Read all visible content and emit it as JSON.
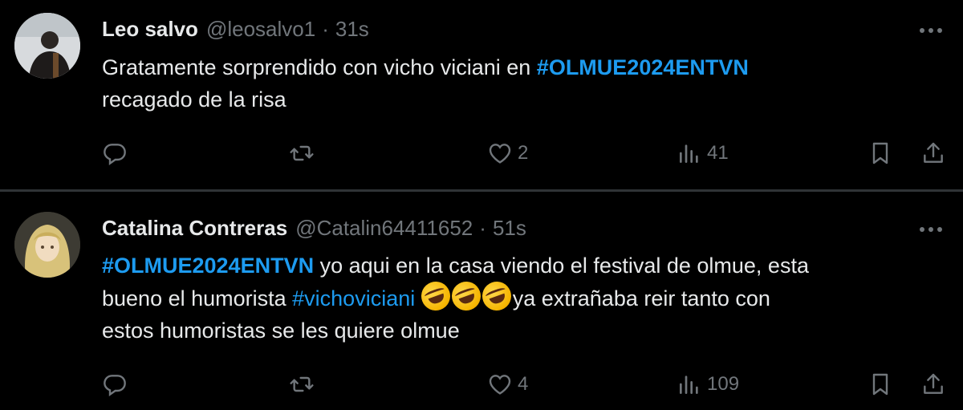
{
  "tweets": [
    {
      "name": "Leo salvo",
      "handle": "@leosalvo1",
      "dot": "·",
      "time": "31s",
      "body": [
        {
          "type": "text",
          "text": "Gratamente sorprendido con vicho viciani en "
        },
        {
          "type": "tag",
          "text": "#OLMUE2024ENTVN"
        },
        {
          "type": "text",
          "text": "\nrecagado de la risa"
        }
      ],
      "counts": {
        "reply": "",
        "retweet": "",
        "like": "2",
        "views": "41"
      }
    },
    {
      "name": "Catalina Contreras",
      "handle": "@Catalin64411652",
      "dot": "·",
      "time": "51s",
      "body": [
        {
          "type": "tag",
          "text": "#OLMUE2024ENTVN"
        },
        {
          "type": "text",
          "text": " yo aqui en la casa viendo el festival de olmue, esta\nbueno el humorista "
        },
        {
          "type": "tag",
          "text": "#vichoviciani"
        },
        {
          "type": "text",
          "text": " "
        },
        {
          "type": "emoji",
          "name": "rolling-on-floor-laughing"
        },
        {
          "type": "emoji",
          "name": "rolling-on-floor-laughing"
        },
        {
          "type": "emoji",
          "name": "rolling-on-floor-laughing"
        },
        {
          "type": "text",
          "text": "ya extrañaba reir tanto con\nestos humoristas se les quiere olmue"
        }
      ],
      "counts": {
        "reply": "",
        "retweet": "",
        "like": "4",
        "views": "109"
      }
    }
  ],
  "icons": [
    "reply-icon",
    "retweet-icon",
    "like-icon",
    "views-icon",
    "bookmark-icon",
    "share-icon",
    "more-icon"
  ],
  "colors": {
    "background": "#000000",
    "text": "#e7e9ea",
    "muted": "#71767b",
    "link": "#1d9bf0",
    "divider": "#2f3336"
  }
}
